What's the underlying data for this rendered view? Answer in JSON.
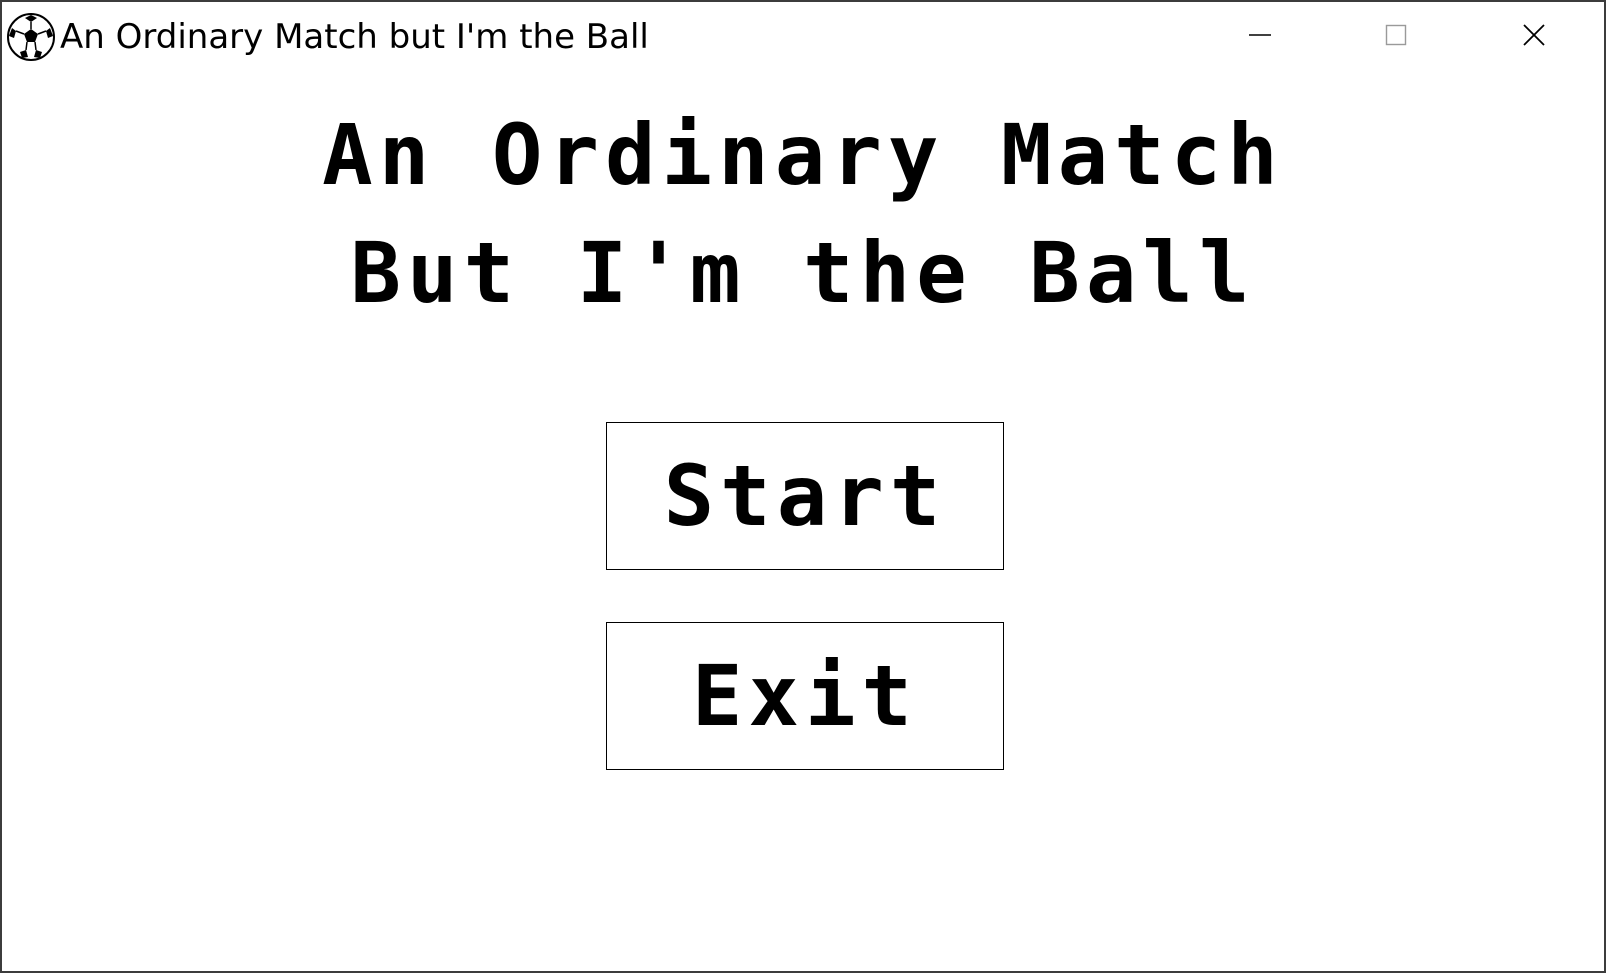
{
  "window": {
    "title": "An Ordinary Match but I'm the Ball",
    "icon": "soccer-ball-icon",
    "controls": [
      "minimize-icon",
      "maximize-icon",
      "close-icon"
    ]
  },
  "menu": {
    "title_line1": "An Ordinary Match",
    "title_line2": "But I'm the Ball",
    "start_label": "Start",
    "exit_label": "Exit"
  },
  "colors": {
    "background": "#ffffff",
    "text": "#000000",
    "border": "#000000"
  }
}
